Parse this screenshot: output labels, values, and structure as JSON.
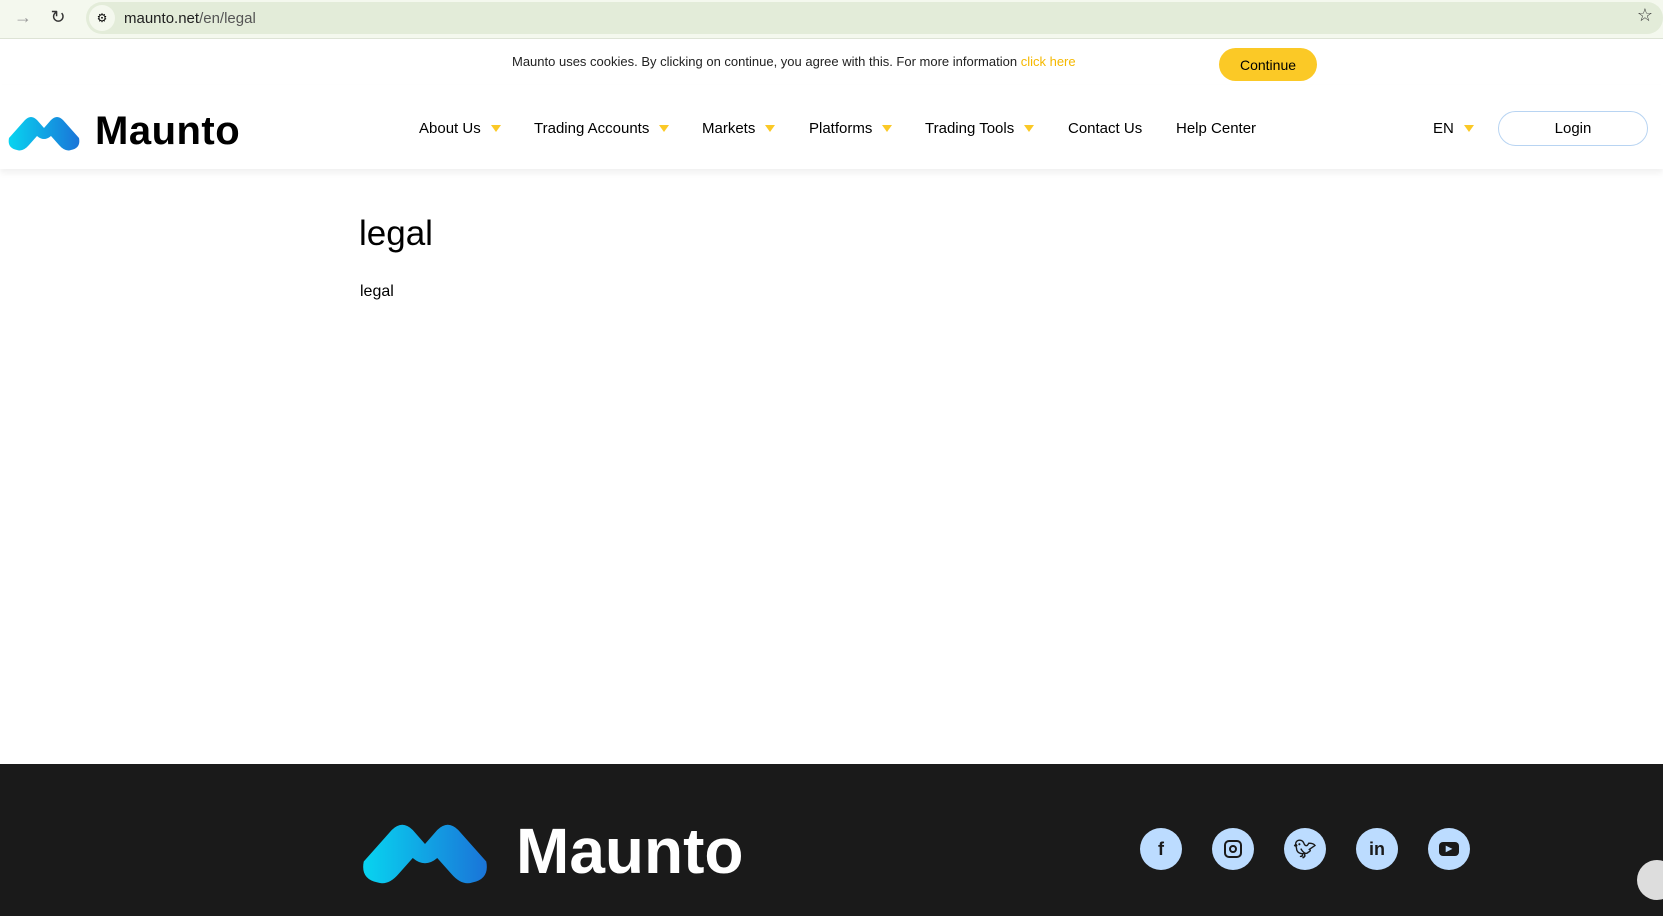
{
  "browser": {
    "url_host": "maunto.net",
    "url_path": "/en/legal"
  },
  "cookie": {
    "text": "Maunto uses cookies. By clicking on continue, you agree with this. For more information ",
    "link": "click here",
    "button": "Continue"
  },
  "header": {
    "brand": "Maunto",
    "nav": [
      "About Us",
      "Trading Accounts",
      "Markets",
      "Platforms",
      "Trading Tools",
      "Contact Us",
      "Help Center"
    ],
    "lang": "EN",
    "login": "Login"
  },
  "main": {
    "title": "legal",
    "body": "legal"
  },
  "footer": {
    "brand": "Maunto",
    "social": [
      "facebook",
      "instagram",
      "twitter",
      "linkedin",
      "youtube"
    ]
  },
  "colors": {
    "accent": "#fbc926",
    "footer_bg": "#1a1a1a",
    "social_bg": "#bcdcff"
  }
}
